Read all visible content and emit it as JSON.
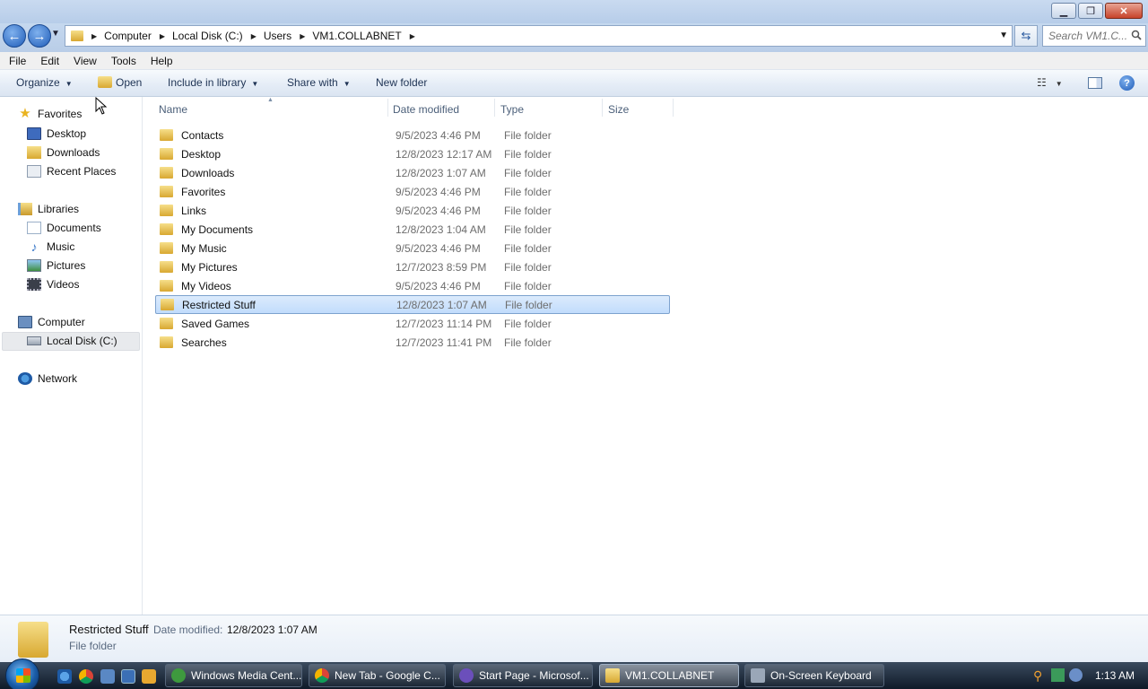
{
  "window": {
    "minimize_glyph": "▁",
    "maximize_glyph": "❐",
    "close_glyph": "✕"
  },
  "nav": {
    "back_glyph": "←",
    "forward_glyph": "→",
    "breadcrumbs": [
      "Computer",
      "Local Disk (C:)",
      "Users",
      "VM1.COLLABNET"
    ],
    "refresh_glyph": "⇆",
    "search_placeholder": "Search VM1.C..."
  },
  "menu": [
    "File",
    "Edit",
    "View",
    "Tools",
    "Help"
  ],
  "commands": {
    "organize": "Organize",
    "open": "Open",
    "include_in_library": "Include in library",
    "share_with": "Share with",
    "new_folder": "New folder",
    "help_glyph": "?"
  },
  "sidebar": {
    "favorites_header": "Favorites",
    "favorites": [
      "Desktop",
      "Downloads",
      "Recent Places"
    ],
    "libraries_header": "Libraries",
    "libraries": [
      "Documents",
      "Music",
      "Pictures",
      "Videos"
    ],
    "computer_header": "Computer",
    "computer": [
      "Local Disk (C:)"
    ],
    "network_header": "Network"
  },
  "columns": [
    "Name",
    "Date modified",
    "Type",
    "Size"
  ],
  "files": [
    {
      "name": "Contacts",
      "date": "9/5/2023 4:46 PM",
      "type": "File folder"
    },
    {
      "name": "Desktop",
      "date": "12/8/2023 12:17 AM",
      "type": "File folder"
    },
    {
      "name": "Downloads",
      "date": "12/8/2023 1:07 AM",
      "type": "File folder"
    },
    {
      "name": "Favorites",
      "date": "9/5/2023 4:46 PM",
      "type": "File folder"
    },
    {
      "name": "Links",
      "date": "9/5/2023 4:46 PM",
      "type": "File folder"
    },
    {
      "name": "My Documents",
      "date": "12/8/2023 1:04 AM",
      "type": "File folder"
    },
    {
      "name": "My Music",
      "date": "9/5/2023 4:46 PM",
      "type": "File folder"
    },
    {
      "name": "My Pictures",
      "date": "12/7/2023 8:59 PM",
      "type": "File folder"
    },
    {
      "name": "My Videos",
      "date": "9/5/2023 4:46 PM",
      "type": "File folder"
    },
    {
      "name": "Restricted Stuff",
      "date": "12/8/2023 1:07 AM",
      "type": "File folder",
      "selected": true
    },
    {
      "name": "Saved Games",
      "date": "12/7/2023 11:14 PM",
      "type": "File folder"
    },
    {
      "name": "Searches",
      "date": "12/7/2023 11:41 PM",
      "type": "File folder"
    }
  ],
  "details": {
    "name": "Restricted Stuff",
    "date_label": "Date modified:",
    "date": "12/8/2023 1:07 AM",
    "type": "File folder"
  },
  "taskbar": {
    "tasks": [
      "Windows Media Cent...",
      "New Tab - Google C...",
      "Start Page - Microsof...",
      "VM1.COLLABNET",
      "On-Screen Keyboard"
    ],
    "active_task": "VM1.COLLABNET",
    "clock": "1:13 AM"
  },
  "colors": {
    "selection": "#c1dcfc",
    "folder": "#e6bd4e",
    "accent": "#1f5cb8"
  }
}
